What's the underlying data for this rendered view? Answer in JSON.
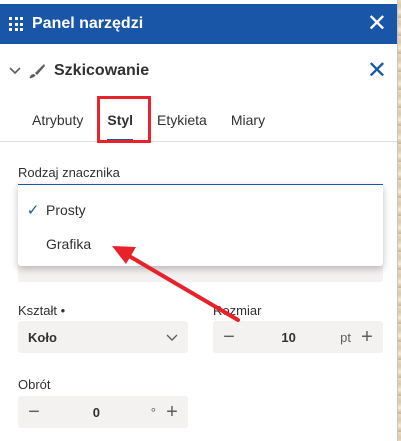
{
  "panel": {
    "title": "Panel narzędzi",
    "close_symbol": "✕"
  },
  "section": {
    "title": "Szkicowanie",
    "close_symbol": "✕"
  },
  "tabs": [
    {
      "label": "Atrybuty",
      "active": false
    },
    {
      "label": "Styl",
      "active": true
    },
    {
      "label": "Etykieta",
      "active": false
    },
    {
      "label": "Miary",
      "active": false
    }
  ],
  "marker_type": {
    "label": "Rodzaj znacznika",
    "options": [
      {
        "label": "Prosty",
        "selected": true
      },
      {
        "label": "Grafika",
        "selected": false
      }
    ],
    "check_symbol": "✓"
  },
  "shape": {
    "label": "Kształt •",
    "value": "Koło"
  },
  "size": {
    "label": "Rozmiar",
    "value": "10",
    "unit": "pt",
    "minus": "−",
    "plus": "+"
  },
  "rotation": {
    "label": "Obrót",
    "value": "0",
    "unit": "°",
    "minus": "−",
    "plus": "+"
  },
  "colors": {
    "header_blue": "#1a56a8",
    "highlight_red": "#e8212b"
  },
  "icons": [
    "grid-icon",
    "close-icon",
    "chevron-down-icon",
    "brush-icon",
    "check-icon",
    "minus-icon",
    "plus-icon"
  ]
}
